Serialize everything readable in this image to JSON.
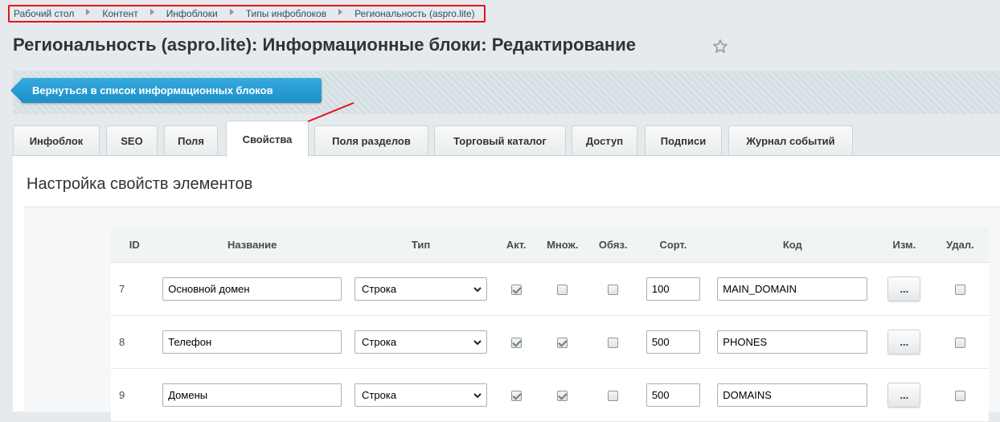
{
  "breadcrumb": {
    "items": [
      "Рабочий стол",
      "Контент",
      "Инфоблоки",
      "Типы инфоблоков",
      "Региональность (aspro.lite)"
    ]
  },
  "page_title": "Региональность (aspro.lite): Информационные блоки: Редактирование",
  "toolbar": {
    "back_label": "Вернуться в список информационных блоков"
  },
  "tabs": [
    {
      "label": "Инфоблок"
    },
    {
      "label": "SEO"
    },
    {
      "label": "Поля"
    },
    {
      "label": "Свойства"
    },
    {
      "label": "Поля разделов"
    },
    {
      "label": "Торговый каталог"
    },
    {
      "label": "Доступ"
    },
    {
      "label": "Подписи"
    },
    {
      "label": "Журнал событий"
    }
  ],
  "active_tab": "Свойства",
  "section_title": "Настройка свойств элементов",
  "table": {
    "headers": {
      "id": "ID",
      "name": "Название",
      "type": "Тип",
      "active": "Акт.",
      "multiple": "Множ.",
      "required": "Обяз.",
      "sort": "Сорт.",
      "code": "Код",
      "edit": "Изм.",
      "delete": "Удал."
    },
    "rows": [
      {
        "id": "7",
        "name": "Основной домен",
        "type": "Строка",
        "active": true,
        "multiple": false,
        "required": false,
        "sort": "100",
        "code": "MAIN_DOMAIN",
        "edit_label": "...",
        "delete": false
      },
      {
        "id": "8",
        "name": "Телефон",
        "type": "Строка",
        "active": true,
        "multiple": true,
        "required": false,
        "sort": "500",
        "code": "PHONES",
        "edit_label": "...",
        "delete": false
      },
      {
        "id": "9",
        "name": "Домены",
        "type": "Строка",
        "active": true,
        "multiple": true,
        "required": false,
        "sort": "500",
        "code": "DOMAINS",
        "edit_label": "...",
        "delete": false
      }
    ]
  },
  "colors": {
    "highlight_border": "#e3121b",
    "annotation_arrow": "#e3121b",
    "back_button": "#1c8fc9"
  },
  "icons": {
    "breadcrumb_separator": "triangle-right-icon",
    "favorite": "star-outline-icon",
    "select": "chevron-down-icon"
  }
}
